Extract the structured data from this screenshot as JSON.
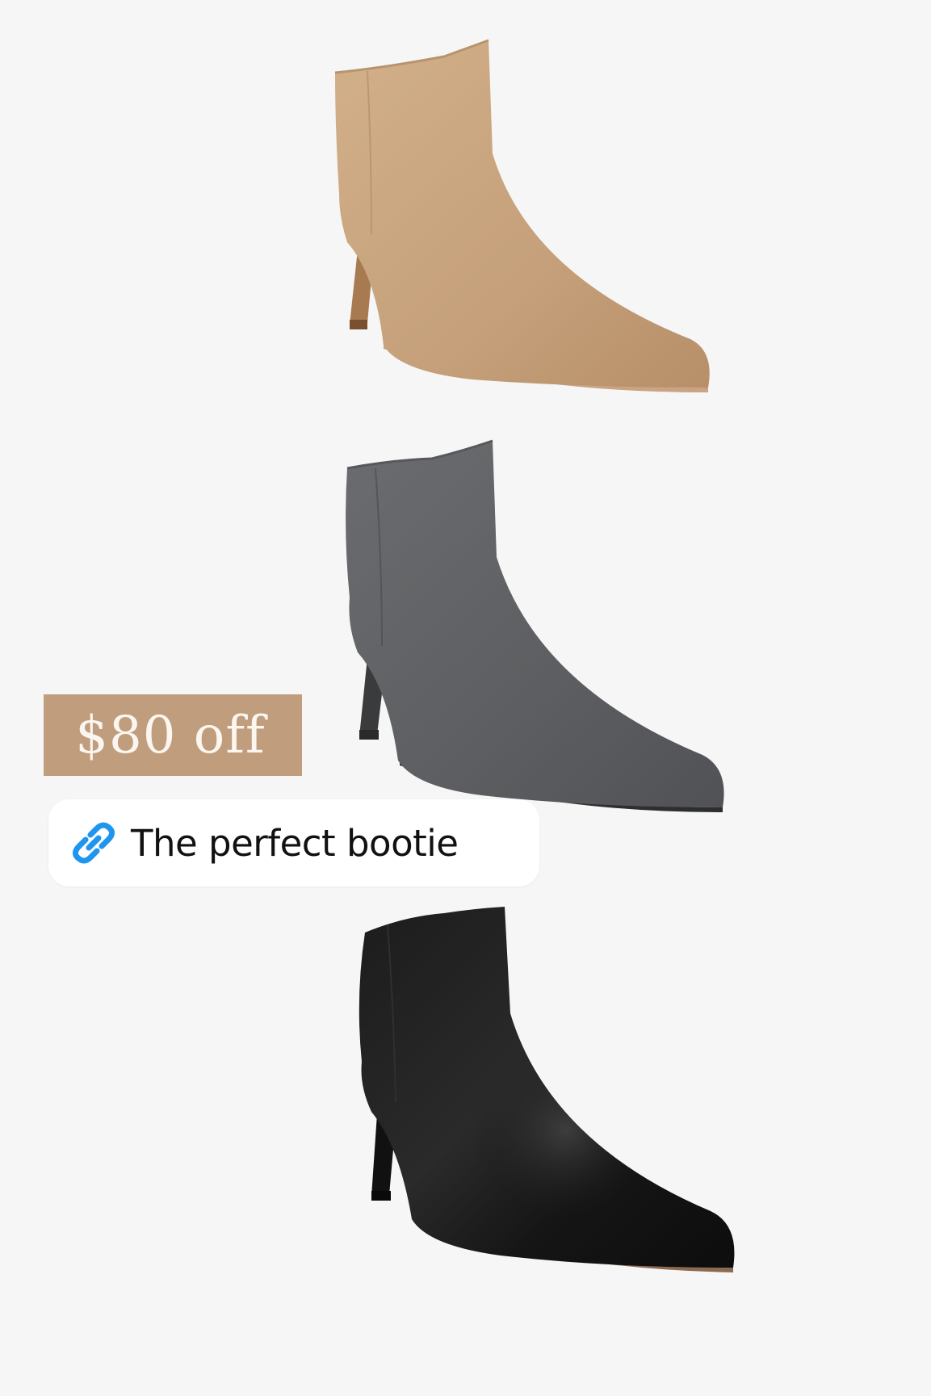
{
  "badge": {
    "text": "$80 off",
    "background": "#bf9d7d",
    "text_color": "#fbf6ef"
  },
  "link": {
    "icon": "link-icon",
    "label": "The perfect bootie",
    "icon_color": "#1e96f0"
  },
  "products": [
    {
      "name": "tan-suede-bootie",
      "color": "#c9a67d"
    },
    {
      "name": "grey-suede-bootie",
      "color": "#5e6063"
    },
    {
      "name": "black-leather-bootie",
      "color": "#161616"
    }
  ]
}
